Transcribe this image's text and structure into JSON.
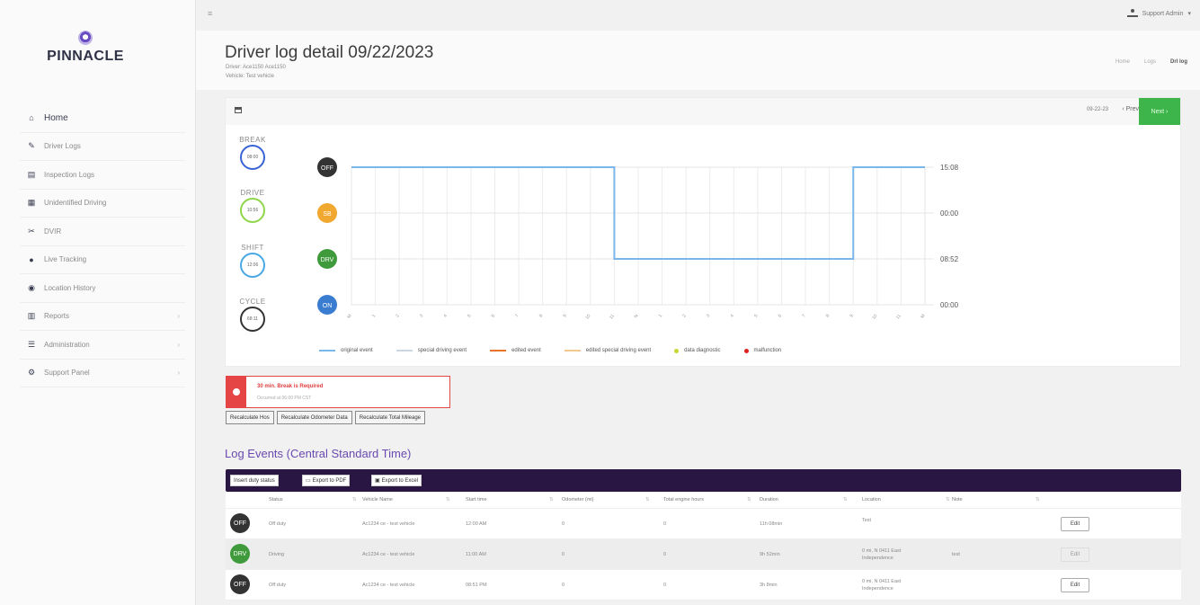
{
  "app": {
    "brand": "PINNACLE",
    "user": "Support Admin"
  },
  "sidebar": {
    "items": [
      {
        "label": "Home",
        "icon": "home-icon",
        "active": true
      },
      {
        "label": "Driver Logs",
        "icon": "logs-icon"
      },
      {
        "label": "Inspection Logs",
        "icon": "clipboard-icon"
      },
      {
        "label": "Unidentified Driving",
        "icon": "calendar-icon"
      },
      {
        "label": "DVIR",
        "icon": "wrench-icon"
      },
      {
        "label": "Live Tracking",
        "icon": "pin-icon"
      },
      {
        "label": "Location History",
        "icon": "history-icon"
      },
      {
        "label": "Reports",
        "icon": "chart-icon",
        "arrow": true
      },
      {
        "label": "Administration",
        "icon": "admin-icon",
        "arrow": true
      },
      {
        "label": "Support Panel",
        "icon": "support-icon",
        "arrow": true
      }
    ]
  },
  "header": {
    "title": "Driver log detail 09/22/2023",
    "driver_line": "Driver: Ace1150 Ace1150",
    "vehicle_line": "Vehicle: Test vehicle",
    "breadcrumbs": [
      "Home",
      "Logs",
      "Drl log"
    ]
  },
  "chart_card": {
    "date": "09-22-23",
    "prev_label": "‹ Prev",
    "next_label": "Next ›",
    "gauges": [
      {
        "label": "BREAK",
        "value": "08:00",
        "color": "#3a63d6"
      },
      {
        "label": "DRIVE",
        "value": "10:56",
        "color": "#8fd64a"
      },
      {
        "label": "SHIFT",
        "value": "12:06",
        "color": "#48a8e6"
      },
      {
        "label": "CYCLE",
        "value": "68:11",
        "color": "#333333"
      }
    ]
  },
  "chart_data": {
    "type": "line",
    "rows": [
      {
        "code": "OFF",
        "color": "#333333",
        "total": "15:08"
      },
      {
        "code": "SB",
        "color": "#f0a830",
        "total": "00:00"
      },
      {
        "code": "DRV",
        "color": "#3e9a3a",
        "total": "08:52"
      },
      {
        "code": "ON",
        "color": "#3a7cd0",
        "total": "00:00"
      }
    ],
    "x_ticks": [
      "M",
      "1",
      "2",
      "3",
      "4",
      "5",
      "6",
      "7",
      "8",
      "9",
      "10",
      "11",
      "N",
      "1",
      "2",
      "3",
      "4",
      "5",
      "6",
      "7",
      "8",
      "9",
      "10",
      "11",
      "M"
    ],
    "segments": [
      {
        "status": "OFF",
        "start": 0,
        "end": 11.0
      },
      {
        "status": "DRV",
        "start": 11.0,
        "end": 21.0
      },
      {
        "status": "OFF",
        "start": 21.0,
        "end": 24
      }
    ],
    "legend": [
      {
        "label": "original event",
        "kind": "line",
        "color": "#7ab6ea"
      },
      {
        "label": "special driving event",
        "kind": "line",
        "color": "#c9d6e6"
      },
      {
        "label": "edited event",
        "kind": "line",
        "color": "#e8742a"
      },
      {
        "label": "edited special driving event",
        "kind": "line",
        "color": "#f0c890"
      },
      {
        "label": "data diagnostic",
        "kind": "dot",
        "color": "#c8d630"
      },
      {
        "label": "malfunction",
        "kind": "dot",
        "color": "#e02020"
      }
    ]
  },
  "alert": {
    "title": "30 min. Break is Required",
    "detail": "Occurred at 06:00 PM CST"
  },
  "actions": {
    "recalc_hos": "Recalculate Hos",
    "recalc_odometer": "Recalculate Odometer Data",
    "recalc_mileage": "Recalculate Total Mileage"
  },
  "log_events": {
    "section_title": "Log Events (Central Standard Time)",
    "toolbar": {
      "insert": "Insert duty status",
      "pdf": "Export to PDF",
      "excel": "Export to Excel"
    },
    "columns": [
      "Status",
      "Vehicle Name",
      "Start time",
      "Odometer (mi)",
      "Total engine hours",
      "Duration",
      "Location",
      "Note"
    ],
    "rows": [
      {
        "code": "OFF",
        "color": "#333333",
        "status": "Off duty",
        "vehicle": "Ac1234 ce - test vehicle",
        "start": "12:00 AM",
        "odometer": "0",
        "engine_hours": "0",
        "duration": "11h 08min",
        "location": "Test",
        "location2": "",
        "note": "",
        "edit": "Edit",
        "alt": false
      },
      {
        "code": "DRV",
        "color": "#3e9a3a",
        "status": "Driving",
        "vehicle": "Ac1234 ce - test vehicle",
        "start": "11:00 AM",
        "odometer": "0",
        "engine_hours": "0",
        "duration": "9h 52min",
        "location": "0 mi, N 0411 East",
        "location2": "Independence",
        "note": "test",
        "edit": "Edit",
        "alt": true
      },
      {
        "code": "OFF",
        "color": "#333333",
        "status": "Off duty",
        "vehicle": "Ac1234 ce - test vehicle",
        "start": "08:51 PM",
        "odometer": "0",
        "engine_hours": "0",
        "duration": "3h 8min",
        "location": "0 mi, N 0411 East",
        "location2": "Independence",
        "note": "",
        "edit": "Edit",
        "alt": false
      }
    ]
  }
}
